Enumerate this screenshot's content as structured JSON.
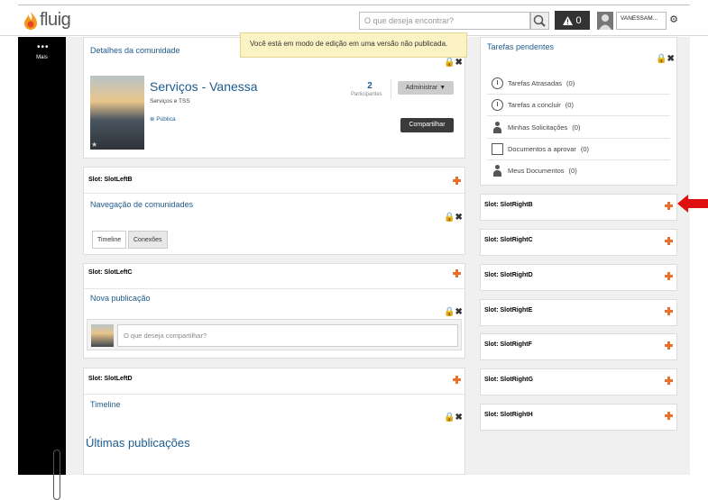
{
  "app": {
    "logo_text": "fluig"
  },
  "header": {
    "search_placeholder": "O que deseja encontrar?",
    "alert_count": "0",
    "user_name": "VANESSAM..."
  },
  "sidebar": {
    "more_label": "Mais"
  },
  "notice": "Você está em modo de edição em uma versão não publicada.",
  "community": {
    "panel_title": "Detalhes da comunidade",
    "name": "Serviços - Vanessa",
    "subtitle": "Serviços e TSS",
    "visibility": "Pública",
    "participants_count": "2",
    "participants_label": "Participantes",
    "admin_button": "Administrar ▼",
    "share_button": "Compartilhar"
  },
  "slots_left": [
    {
      "slot": "Slot: SlotLeftB",
      "title": "Navegação de comunidades",
      "tabs": [
        "Timeline",
        "Conexões"
      ]
    },
    {
      "slot": "Slot: SlotLeftC",
      "title": "Nova publicação",
      "compose_placeholder": "O que deseja compartilhar?"
    },
    {
      "slot": "Slot: SlotLeftD",
      "title": "Timeline",
      "heading": "Últimas publicações"
    }
  ],
  "tasks": {
    "title": "Tarefas pendentes",
    "items": [
      {
        "label": "Tarefas Atrasadas",
        "count": "(0)"
      },
      {
        "label": "Tarefas a concluir",
        "count": "(0)"
      },
      {
        "label": "Minhas Solicitações",
        "count": "(0)"
      },
      {
        "label": "Documentos a aprovar",
        "count": "(0)"
      },
      {
        "label": "Meus Documentos",
        "count": "(0)"
      }
    ]
  },
  "slots_right": [
    "Slot: SlotRightB",
    "Slot: SlotRightC",
    "Slot: SlotRightD",
    "Slot: SlotRightE",
    "Slot: SlotRightF",
    "Slot: SlotRightG",
    "Slot: SlotRightH"
  ],
  "colors": {
    "link_blue": "#1e5b8e",
    "slot_plus_orange": "#e8702a",
    "annotation_arrow_red": "#e01010"
  }
}
